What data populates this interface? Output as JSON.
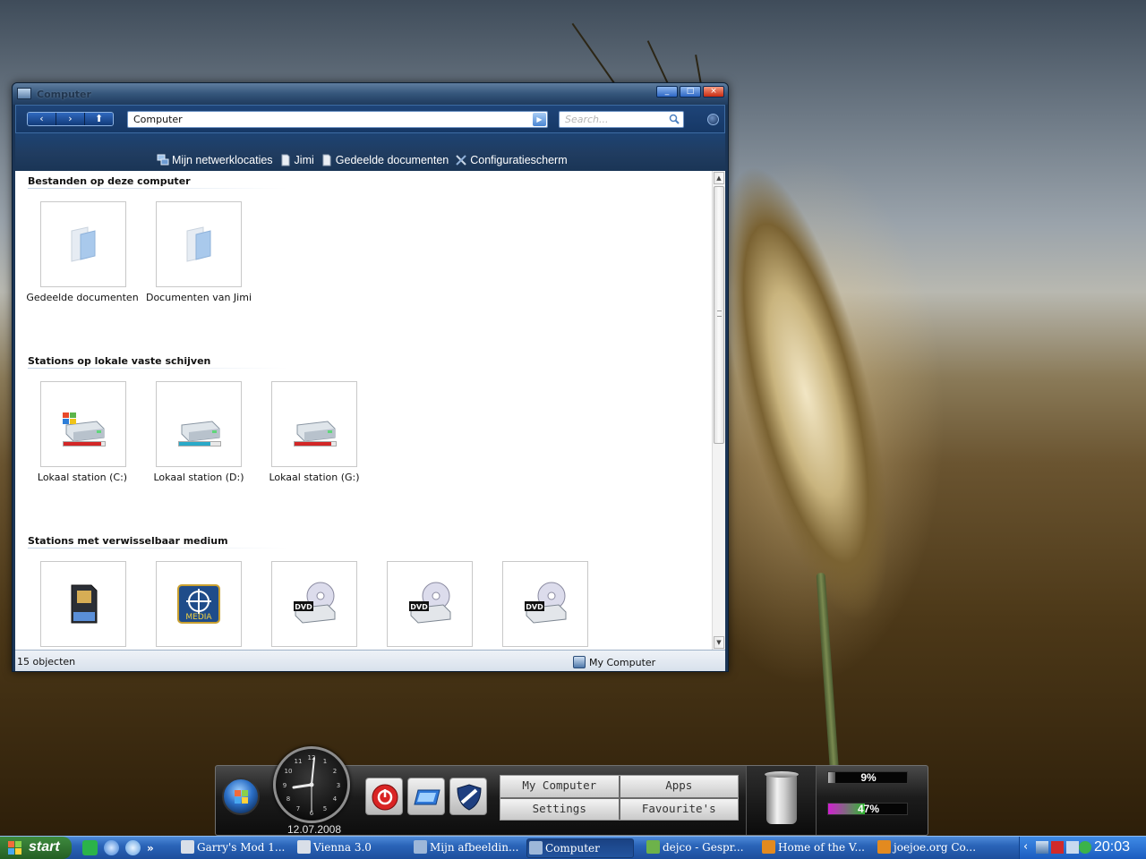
{
  "window": {
    "title": "Computer",
    "address": "Computer",
    "search_placeholder": "Search...",
    "nav": {
      "back": "‹",
      "forward": "›",
      "up": "⬆"
    },
    "shortcuts": [
      {
        "label": "Mijn netwerklocaties",
        "icon": "network-icon"
      },
      {
        "label": "Jimi",
        "icon": "document-icon"
      },
      {
        "label": "Gedeelde documenten",
        "icon": "document-icon"
      },
      {
        "label": "Configuratiescherm",
        "icon": "control-panel-icon"
      }
    ],
    "groups": [
      {
        "header": "Bestanden op deze computer",
        "items": [
          {
            "label": "Gedeelde documenten",
            "icon": "folder-icon"
          },
          {
            "label": "Documenten van Jimi",
            "icon": "folder-icon"
          }
        ]
      },
      {
        "header": "Stations op lokale vaste schijven",
        "items": [
          {
            "label": "Lokaal station (C:)",
            "icon": "windows-drive-icon",
            "usage_fraction": 0.92,
            "bar_color": "#d32626"
          },
          {
            "label": "Lokaal station (D:)",
            "icon": "hard-drive-icon",
            "usage_fraction": 0.75,
            "bar_color": "#29a9c8"
          },
          {
            "label": "Lokaal station (G:)",
            "icon": "hard-drive-icon",
            "usage_fraction": 0.9,
            "bar_color": "#d32626"
          }
        ]
      },
      {
        "header": "Stations met verwisselbaar medium",
        "items": [
          {
            "label": "",
            "icon": "sd-card-icon"
          },
          {
            "label": "",
            "icon": "media-drive-icon",
            "badge": "MEDIA"
          },
          {
            "label": "",
            "icon": "dvd-drive-icon",
            "badge": "DVD"
          },
          {
            "label": "",
            "icon": "dvd-drive-icon",
            "badge": "DVD"
          },
          {
            "label": "",
            "icon": "dvd-drive-icon",
            "badge": "DVD"
          }
        ]
      }
    ],
    "status": {
      "count": "15 objecten",
      "location": "My Computer"
    }
  },
  "dock": {
    "date": "12.07.2008",
    "menu": [
      "My Computer",
      "Apps",
      "Settings",
      "Favourite's"
    ],
    "cpu_label": "9%",
    "cpu_fraction": 0.09,
    "ram_label": "47%",
    "ram_fraction": 0.47
  },
  "taskbar": {
    "start_label": "start",
    "quicklaunch_more": "»",
    "tasks": [
      {
        "label": "Garry's Mod 1...",
        "active": false,
        "icon_color": "#d9dfe8"
      },
      {
        "label": "Vienna 3.0",
        "active": false,
        "icon_color": "#d9dfe8"
      },
      {
        "label": "Mijn afbeeldin...",
        "active": false,
        "icon_color": "#9db7d9"
      },
      {
        "label": "Computer",
        "active": true,
        "icon_color": "#9db7d9"
      },
      {
        "label": "dejco - Gespr...",
        "active": false,
        "icon_color": "#6db24a"
      },
      {
        "label": "Home of the V...",
        "active": false,
        "icon_color": "#e38a1f"
      },
      {
        "label": "joejoe.org Co...",
        "active": false,
        "icon_color": "#e38a1f"
      }
    ],
    "tray_arrow": "‹",
    "time": "20:03"
  },
  "colors": {
    "window_frame": "#1b3556",
    "taskbar_blue": "#2a64b8",
    "start_green": "#3e8a3e"
  }
}
